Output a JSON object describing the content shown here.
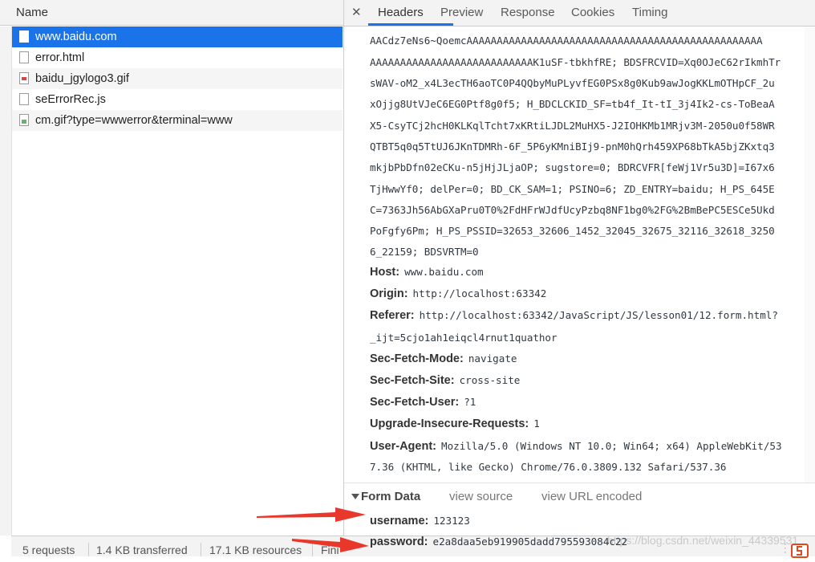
{
  "left": {
    "name_header": "Name",
    "requests": [
      {
        "name": "www.baidu.com",
        "icon": "document-icon",
        "selected": true
      },
      {
        "name": "error.html",
        "icon": "document-icon",
        "selected": false
      },
      {
        "name": "baidu_jgylogo3.gif",
        "icon": "image-icon",
        "selected": false
      },
      {
        "name": "seErrorRec.js",
        "icon": "document-icon",
        "selected": false
      },
      {
        "name": "cm.gif?type=wwwerror&terminal=www",
        "icon": "image-icon",
        "selected": false
      }
    ]
  },
  "status": {
    "requests": "5 requests",
    "transferred": "1.4 KB transferred",
    "resources": "17.1 KB resources",
    "finish": "Fini"
  },
  "tabs": {
    "close": "✕",
    "items": [
      "Headers",
      "Preview",
      "Response",
      "Cookies",
      "Timing"
    ],
    "active": "Headers"
  },
  "cookie_lines": [
    "AACdz7eNs6~QoemcAAAAAAAAAAAAAAAAAAAAAAAAAAAAAAAAAAAAAAAAAAAAAAAAA",
    "AAAAAAAAAAAAAAAAAAAAAAAAAAAK1uSF-tbkhfRE; BDSFRCVID=Xq0OJeC62rIkmhTr",
    "sWAV-oM2_x4L3ecTH6aoTC0P4QQbyMuPLyvfEG0PSx8g0Kub9awJogKKLmOTHpCF_2u",
    "xOjjg8UtVJeC6EG0Ptf8g0f5; H_BDCLCKID_SF=tb4f_It-tI_3j4Ik2-cs-ToBeaA",
    "X5-CsyTCj2hcH0KLKqlTcht7xKRtiLJDL2MuHX5-J2IOHKMb1MRjv3M-2050u0f58WR",
    "QTBT5q0q5TtUJ6JKnTDMRh-6F_5P6yKMniBIj9-pnM0hQrh459XP68bTkA5bjZKxtq3",
    "mkjbPbDfn02eCKu-n5jHjJLjaOP; sugstore=0; BDRCVFR[feWj1Vr5u3D]=I67x6",
    "TjHwwYf0; delPer=0; BD_CK_SAM=1; PSINO=6; ZD_ENTRY=baidu; H_PS_645E",
    "C=7363Jh56AbGXaPru0T0%2FdHFrWJdfUcyPzbq8NF1bg0%2FG%2BmBePC5ESCe5Ukd",
    "PoFgfy6Pm; H_PS_PSSID=32653_32606_1452_32045_32675_32116_32618_3250",
    "6_22159; BDSVRTM=0"
  ],
  "headers": [
    {
      "key": "Host:",
      "value": "www.baidu.com"
    },
    {
      "key": "Origin:",
      "value": "http://localhost:63342"
    },
    {
      "key": "Referer:",
      "value": "http://localhost:63342/JavaScript/JS/lesson01/12.form.html?"
    },
    {
      "key": "",
      "value": "_ijt=5cjo1ah1eiqcl4rnut1quathor"
    },
    {
      "key": "Sec-Fetch-Mode:",
      "value": "navigate"
    },
    {
      "key": "Sec-Fetch-Site:",
      "value": "cross-site"
    },
    {
      "key": "Sec-Fetch-User:",
      "value": "?1"
    },
    {
      "key": "Upgrade-Insecure-Requests:",
      "value": "1"
    },
    {
      "key": "User-Agent:",
      "value": "Mozilla/5.0 (Windows NT 10.0; Win64; x64) AppleWebKit/53"
    },
    {
      "key": "",
      "value": "7.36 (KHTML, like Gecko) Chrome/76.0.3809.132 Safari/537.36"
    }
  ],
  "form": {
    "title": "Form Data",
    "view_source": "view source",
    "view_url_encoded": "view URL encoded",
    "fields": [
      {
        "key": "username:",
        "value": "123123"
      },
      {
        "key": "password:",
        "value": "e2a8daa5eb919905dadd795593084c22"
      }
    ]
  },
  "watermark": "https://blog.csdn.net/weixin_44339531",
  "colors": {
    "accent": "#1a73e8",
    "arrow": "#e8382c"
  }
}
